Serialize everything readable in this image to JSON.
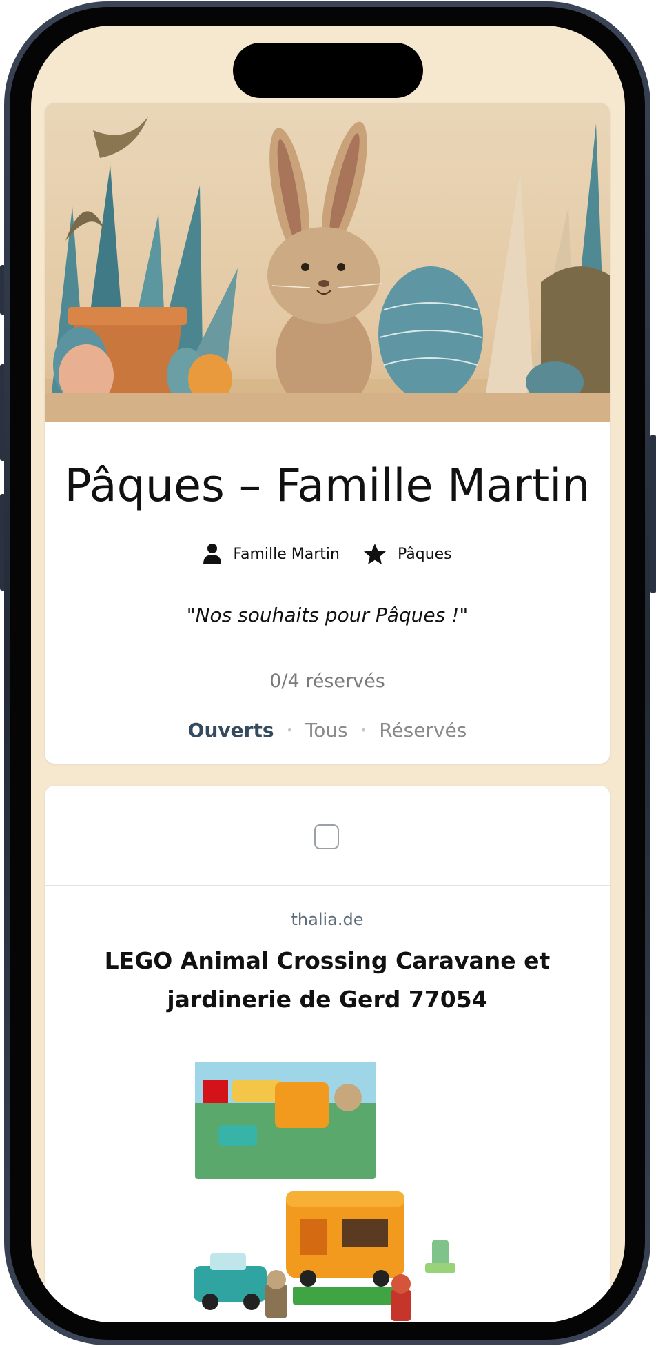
{
  "list": {
    "title": "Pâques – Famille Martin",
    "owner": "Famille Martin",
    "occasion": "Pâques",
    "message": "\"Nos souhaits pour Pâques !\"",
    "reserved_count": "0/4 réservés",
    "hero_image": "easter-bunny-illustration"
  },
  "filters": [
    {
      "label": "Ouverts",
      "active": true
    },
    {
      "label": "Tous",
      "active": false
    },
    {
      "label": "Réservés",
      "active": false
    }
  ],
  "items": [
    {
      "source": "thalia.de",
      "title": "LEGO Animal Crossing Caravane et jardinerie de Gerd 77054",
      "checked": false,
      "product_image": "lego-animal-crossing-set"
    }
  ],
  "icons": {
    "owner": "person-icon",
    "occasion": "star-icon"
  },
  "colors": {
    "background": "#f6e7cf",
    "card": "#ffffff",
    "active_filter": "#344a5e",
    "inactive_filter": "#8a8a8a",
    "muted_text": "#7a7a7a",
    "source_text": "#5d6b7a"
  }
}
